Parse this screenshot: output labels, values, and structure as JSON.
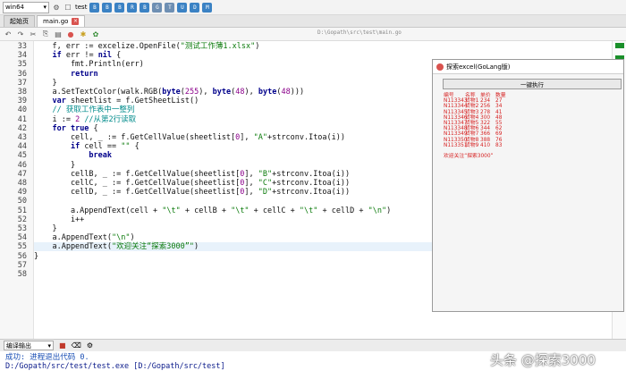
{
  "toolbar": {
    "build_target": "win64",
    "test_label": "test",
    "buttons": [
      "B",
      "B",
      "B",
      "R",
      "B",
      "G",
      "T",
      "U",
      "D",
      "M"
    ]
  },
  "tabs": [
    {
      "label": "起始页",
      "active": false
    },
    {
      "label": "main.go",
      "active": true
    }
  ],
  "editor": {
    "file_path": "D:\\Gopath\\src\\test\\main.go",
    "lines": [
      {
        "n": "33",
        "html": "    f, err := excelize.OpenFile(<span class='str'>\"测试工作薄1.xlsx\"</span>)"
      },
      {
        "n": "34",
        "html": "    <span class='kw'>if</span> err != <span class='kw'>nil</span> {"
      },
      {
        "n": "35",
        "html": "        fmt.Println(err)"
      },
      {
        "n": "36",
        "html": "        <span class='kw'>return</span>"
      },
      {
        "n": "37",
        "html": "    }"
      },
      {
        "n": "38",
        "html": "    a.SetTextColor(walk.RGB(<span class='kw'>byte</span>(<span class='num'>255</span>), <span class='kw'>byte</span>(<span class='num'>48</span>), <span class='kw'>byte</span>(<span class='num'>48</span>)))"
      },
      {
        "n": "39",
        "html": "    <span class='kw'>var</span> sheetlist = f.GetSheetList()"
      },
      {
        "n": "40",
        "html": "    <span class='com'>// 获取工作表中一整列</span>"
      },
      {
        "n": "41",
        "html": "    i := <span class='num'>2</span> <span class='com'>//从第2行读取</span>"
      },
      {
        "n": "42",
        "html": "    <span class='kw'>for true</span> {"
      },
      {
        "n": "43",
        "html": "        cell, _ := f.GetCellValue(sheetlist[<span class='num'>0</span>], <span class='str'>\"A\"</span>+strconv.Itoa(i))"
      },
      {
        "n": "44",
        "html": "        <span class='kw'>if</span> cell == <span class='str'>\"\"</span> {"
      },
      {
        "n": "45",
        "html": "            <span class='kw'>break</span>"
      },
      {
        "n": "46",
        "html": "        }"
      },
      {
        "n": "47",
        "html": "        cellB, _ := f.GetCellValue(sheetlist[<span class='num'>0</span>], <span class='str'>\"B\"</span>+strconv.Itoa(i))"
      },
      {
        "n": "48",
        "html": "        cellC, _ := f.GetCellValue(sheetlist[<span class='num'>0</span>], <span class='str'>\"C\"</span>+strconv.Itoa(i))"
      },
      {
        "n": "49",
        "html": "        cellD, _ := f.GetCellValue(sheetlist[<span class='num'>0</span>], <span class='str'>\"D\"</span>+strconv.Itoa(i))"
      },
      {
        "n": "50",
        "html": ""
      },
      {
        "n": "51",
        "html": "        a.AppendText(cell + <span class='str'>\"\\t\"</span> + cellB + <span class='str'>\"\\t\"</span> + cellC + <span class='str'>\"\\t\"</span> + cellD + <span class='str'>\"\\n\"</span>)"
      },
      {
        "n": "52",
        "html": "        i++"
      },
      {
        "n": "53",
        "html": "    }"
      },
      {
        "n": "54",
        "html": "    a.AppendText(<span class='str'>\"\\n\"</span>)"
      },
      {
        "n": "55",
        "html": "    a.AppendText(<span class='str'>\"欢迎关注“探索3000”\"</span>)"
      },
      {
        "n": "56",
        "html": "}"
      },
      {
        "n": "57",
        "html": ""
      },
      {
        "n": "58",
        "html": ""
      }
    ]
  },
  "app_window": {
    "title": "探索excel(GoLang版)",
    "run_button": "一键执行",
    "headers": [
      "编号",
      "名称",
      "单价",
      "数量"
    ],
    "rows": [
      [
        "N113343",
        "货物1",
        "234",
        "27"
      ],
      [
        "N113344",
        "货物2",
        "256",
        "34"
      ],
      [
        "N113345",
        "货物3",
        "278",
        "41"
      ],
      [
        "N113346",
        "货物4",
        "300",
        "48"
      ],
      [
        "N113347",
        "货物5",
        "322",
        "55"
      ],
      [
        "N113348",
        "货物6",
        "344",
        "62"
      ],
      [
        "N113349",
        "货物7",
        "366",
        "69"
      ],
      [
        "N113350",
        "货物8",
        "388",
        "76"
      ],
      [
        "N113351",
        "货物9",
        "410",
        "83"
      ]
    ],
    "footer_text": "欢迎关注“探索3000”"
  },
  "output": {
    "panel_label": "编译输出",
    "line1": "成功: 进程退出代码 0.",
    "line2": "D:/Gopath/src/test/test.exe  [D:/Gopath/src/test]"
  },
  "watermark": "头条 @探索3000"
}
